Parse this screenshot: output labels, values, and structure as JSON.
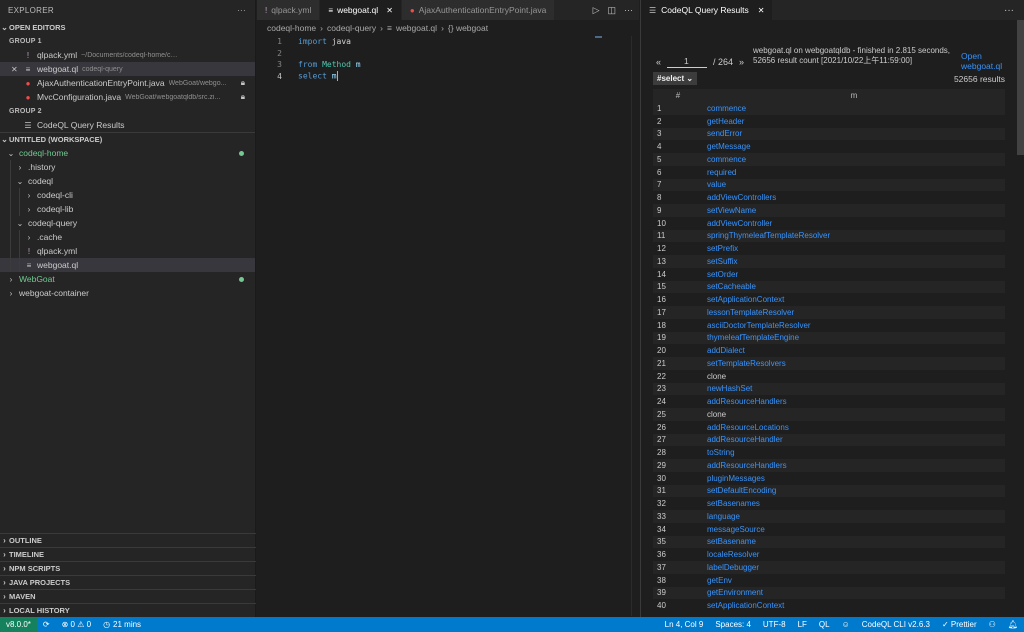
{
  "sidebar": {
    "title": "EXPLORER",
    "open_editors": {
      "heading": "OPEN EDITORS",
      "group1_label": "GROUP 1",
      "group2_label": "GROUP 2",
      "group1": [
        {
          "name": "qlpack.yml",
          "desc": "~/Documents/codeql-home/codeql-query",
          "icon": "yaml-icon"
        },
        {
          "name": "webgoat.ql",
          "desc": "codeql-query",
          "icon": "ql-file-icon"
        },
        {
          "name": "AjaxAuthenticationEntryPoint.java",
          "desc": "WebGoat/webgo...",
          "icon": "error-dot-icon"
        },
        {
          "name": "MvcConfiguration.java",
          "desc": "WebGoat/webgoatqldb/src.zi...",
          "icon": "error-dot-icon"
        }
      ],
      "group2": [
        {
          "name": "CodeQL Query Results",
          "icon": "preview-icon"
        }
      ]
    },
    "workspace": {
      "heading": "UNTITLED (WORKSPACE)",
      "items": [
        {
          "label": "codeql-home",
          "level": 0,
          "chevron": "open",
          "color": "#73c991",
          "dot": true
        },
        {
          "label": ".history",
          "level": 1,
          "chevron": "closed"
        },
        {
          "label": "codeql",
          "level": 1,
          "chevron": "open"
        },
        {
          "label": "codeql-cli",
          "level": 2,
          "chevron": "closed"
        },
        {
          "label": "codeql-lib",
          "level": 2,
          "chevron": "closed"
        },
        {
          "label": "codeql-query",
          "level": 1,
          "chevron": "open"
        },
        {
          "label": ".cache",
          "level": 2,
          "chevron": "closed"
        },
        {
          "label": "qlpack.yml",
          "level": 2,
          "chevron": "none",
          "icon": "!"
        },
        {
          "label": "webgoat.ql",
          "level": 2,
          "chevron": "none",
          "icon": "≡",
          "selected": true
        },
        {
          "label": "WebGoat",
          "level": 0,
          "chevron": "closed",
          "color": "#73c991",
          "dot": true
        },
        {
          "label": "webgoat-container",
          "level": 0,
          "chevron": "closed"
        }
      ]
    },
    "bottom_sections": [
      "OUTLINE",
      "TIMELINE",
      "NPM SCRIPTS",
      "JAVA PROJECTS",
      "MAVEN",
      "LOCAL HISTORY"
    ]
  },
  "editor": {
    "tabs": [
      {
        "label": "qlpack.yml",
        "icon": "!",
        "active": false
      },
      {
        "label": "webgoat.ql",
        "icon": "≡",
        "active": true
      },
      {
        "label": "AjaxAuthenticationEntryPoint.java",
        "icon": "●",
        "active": false
      }
    ],
    "breadcrumb": [
      "codeql-home",
      "codeql-query",
      "webgoat.ql",
      "{} webgoat"
    ],
    "lines": [
      {
        "num": "1",
        "kw": "import",
        "rest": " java"
      },
      {
        "num": "2",
        "kw": "",
        "rest": ""
      },
      {
        "num": "3",
        "kw": "from",
        "type": " Method",
        "var": " m"
      },
      {
        "num": "4",
        "kw": "select",
        "var": " m"
      }
    ]
  },
  "results": {
    "tab_label": "CodeQL Query Results",
    "page_current": "1",
    "page_total": "/ 264",
    "status": "webgoat.ql on webgoatqldb - finished in 2.815 seconds, 52656 result count [2021/10/22上午11:59:00]",
    "open_link": "Open webgoat.ql",
    "select_label": "#select",
    "result_count": "52656 results",
    "col_num": "#",
    "col_m": "m",
    "rows": [
      [
        "1",
        "commence",
        true
      ],
      [
        "2",
        "getHeader",
        true
      ],
      [
        "3",
        "sendError",
        true
      ],
      [
        "4",
        "getMessage",
        true
      ],
      [
        "5",
        "commence",
        true
      ],
      [
        "6",
        "required",
        true
      ],
      [
        "7",
        "value",
        true
      ],
      [
        "8",
        "addViewControllers",
        true
      ],
      [
        "9",
        "setViewName",
        true
      ],
      [
        "10",
        "addViewController",
        true
      ],
      [
        "11",
        "springThymeleafTemplateResolver",
        true
      ],
      [
        "12",
        "setPrefix",
        true
      ],
      [
        "13",
        "setSuffix",
        true
      ],
      [
        "14",
        "setOrder",
        true
      ],
      [
        "15",
        "setCacheable",
        true
      ],
      [
        "16",
        "setApplicationContext",
        true
      ],
      [
        "17",
        "lessonTemplateResolver",
        true
      ],
      [
        "18",
        "asciiDoctorTemplateResolver",
        true
      ],
      [
        "19",
        "thymeleafTemplateEngine",
        true
      ],
      [
        "20",
        "addDialect",
        true
      ],
      [
        "21",
        "setTemplateResolvers",
        true
      ],
      [
        "22",
        "clone",
        false
      ],
      [
        "23",
        "newHashSet",
        true
      ],
      [
        "24",
        "addResourceHandlers",
        true
      ],
      [
        "25",
        "clone",
        false
      ],
      [
        "26",
        "addResourceLocations",
        true
      ],
      [
        "27",
        "addResourceHandler",
        true
      ],
      [
        "28",
        "toString",
        true
      ],
      [
        "29",
        "addResourceHandlers",
        true
      ],
      [
        "30",
        "pluginMessages",
        true
      ],
      [
        "31",
        "setDefaultEncoding",
        true
      ],
      [
        "32",
        "setBasenames",
        true
      ],
      [
        "33",
        "language",
        true
      ],
      [
        "34",
        "messageSource",
        true
      ],
      [
        "35",
        "setBasename",
        true
      ],
      [
        "36",
        "localeResolver",
        true
      ],
      [
        "37",
        "labelDebugger",
        true
      ],
      [
        "38",
        "getEnv",
        true
      ],
      [
        "39",
        "getEnvironment",
        true
      ],
      [
        "40",
        "setApplicationContext",
        true
      ]
    ]
  },
  "statusbar": {
    "version": "v8.0.0*",
    "sync": "⟳",
    "errors": "⊗ 0 ⚠ 0",
    "time": "21 mins",
    "position": "Ln 4, Col 9",
    "spaces": "Spaces: 4",
    "encoding": "UTF-8",
    "eol": "LF",
    "language": "QL",
    "codeql": "CodeQL CLI v2.6.3",
    "prettier": "✓ Prettier"
  },
  "colors": {
    "accent": "#007acc",
    "link": "#3794ff",
    "git_added": "#73c991",
    "error": "#f14c4c"
  }
}
